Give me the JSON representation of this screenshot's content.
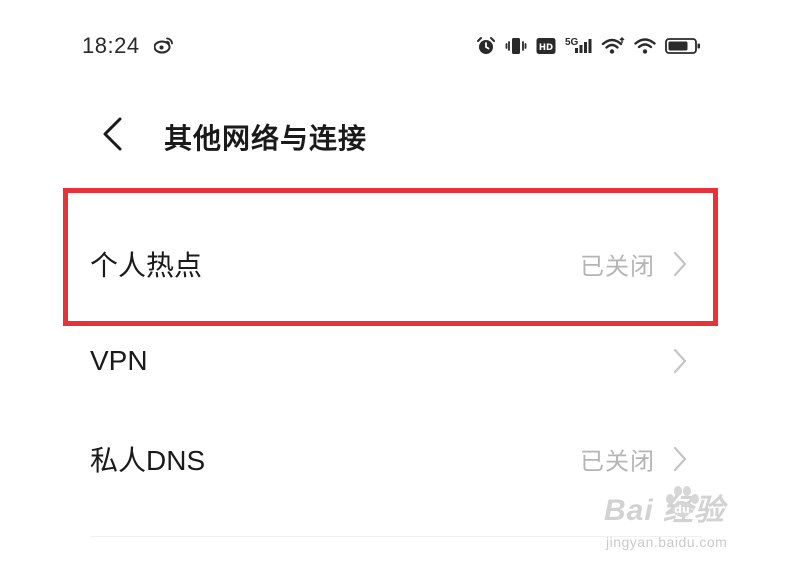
{
  "status_bar": {
    "time": "18:24",
    "network_type": "5G",
    "icons": [
      "weibo-icon",
      "alarm-icon",
      "vibrate-icon",
      "hd-icon",
      "signal-5g-icon",
      "wifi-tether-icon",
      "wifi-icon",
      "battery-icon"
    ]
  },
  "header": {
    "title": "其他网络与连接"
  },
  "settings": {
    "items": [
      {
        "label": "个人热点",
        "value": "已关闭"
      },
      {
        "label": "VPN",
        "value": ""
      },
      {
        "label": "私人DNS",
        "value": "已关闭"
      }
    ]
  },
  "watermark": {
    "logo_text": "Bai  经验",
    "url": "jingyan.baidu.com"
  },
  "colors": {
    "highlight_border": "#e8323a",
    "secondary_text": "#b5b5b5",
    "primary_text": "#1a1a1a"
  }
}
